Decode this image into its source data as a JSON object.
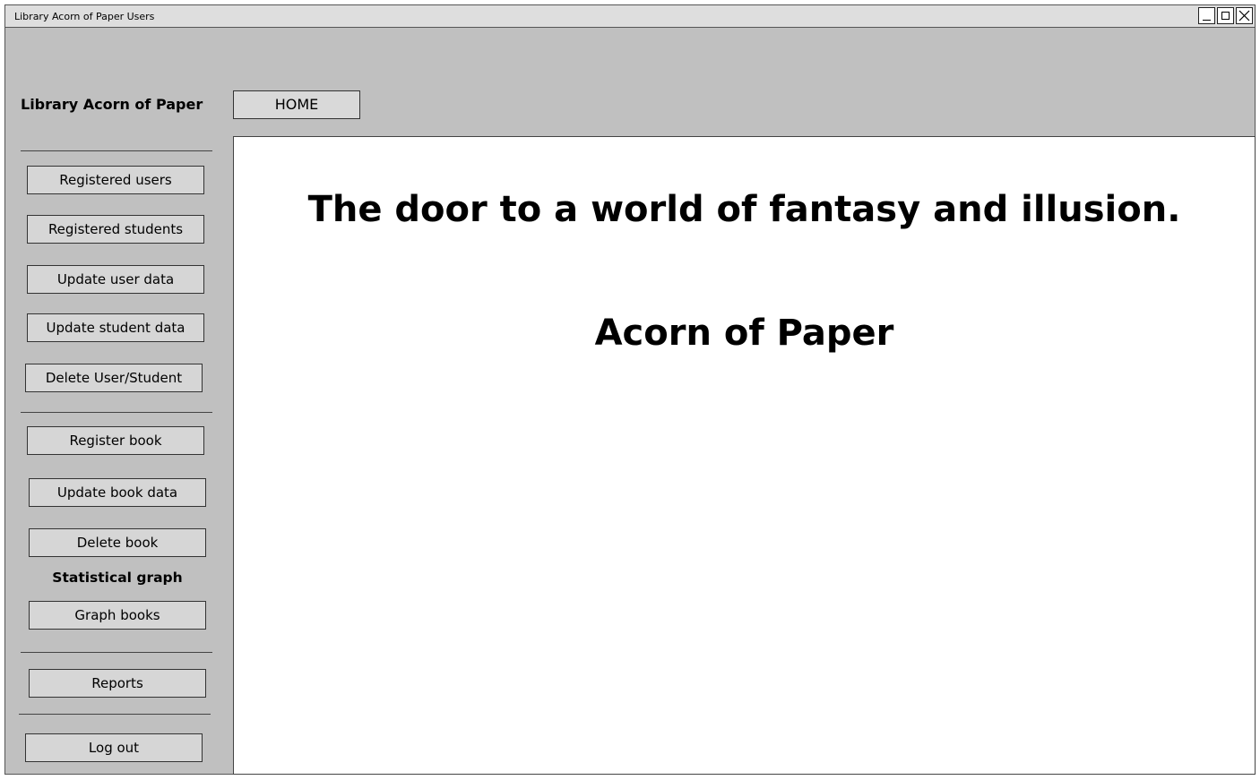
{
  "window": {
    "title": "Library Acorn of Paper Users",
    "controls": [
      "minimize-icon",
      "maximize-icon",
      "close-icon"
    ]
  },
  "header": {
    "app_name": "Library Acorn of Paper",
    "home_label": "HOME"
  },
  "sidebar": {
    "users": {
      "registered_users": "Registered users",
      "registered_students": "Registered students",
      "update_user_data": "Update user data",
      "update_student_data": "Update student data",
      "delete_user_student": "Delete User/Student"
    },
    "books": {
      "register_book": "Register book",
      "update_book_data": "Update book data",
      "delete_book": "Delete book"
    },
    "statistics": {
      "heading": "Statistical graph",
      "graph_books": "Graph books"
    },
    "reports": "Reports",
    "log_out": "Log out"
  },
  "main": {
    "tagline": "The door to a world of fantasy and illusion.",
    "brand": "Acorn of Paper"
  }
}
